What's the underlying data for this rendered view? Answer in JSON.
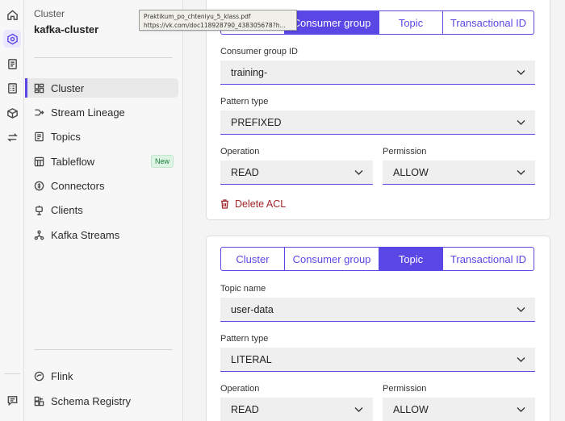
{
  "tooltip": {
    "line1": "Praktikum_po_chteniyu_5_klass.pdf",
    "line2": "https://vk.com/doc118928790_438305678?h..."
  },
  "rail": {
    "icons": [
      "home-icon",
      "environment-icon",
      "document-icon",
      "catalog-icon",
      "box-icon",
      "swap-icon",
      "chat-icon"
    ]
  },
  "sidebar": {
    "caption": "Cluster",
    "cluster_name": "kafka-cluster",
    "items": [
      {
        "label": "Cluster",
        "icon": "dashboard-icon",
        "active": true
      },
      {
        "label": "Stream Lineage",
        "icon": "lineage-icon"
      },
      {
        "label": "Topics",
        "icon": "topics-icon"
      },
      {
        "label": "Tableflow",
        "icon": "tableflow-icon",
        "badge": "New"
      },
      {
        "label": "Connectors",
        "icon": "connectors-icon"
      },
      {
        "label": "Clients",
        "icon": "clients-icon"
      },
      {
        "label": "Kafka Streams",
        "icon": "streams-icon"
      }
    ],
    "bottom_items": [
      {
        "label": "Flink",
        "icon": "flink-icon"
      },
      {
        "label": "Schema Registry",
        "icon": "schema-icon"
      }
    ]
  },
  "acl1": {
    "tabs": [
      "Consumer group",
      "Topic",
      "Transactional ID"
    ],
    "selected_tab": "Consumer group",
    "id_label": "Consumer group ID",
    "id_value": "training-",
    "pattern_label": "Pattern type",
    "pattern_value": "PREFIXED",
    "operation_label": "Operation",
    "operation_value": "READ",
    "permission_label": "Permission",
    "permission_value": "ALLOW",
    "delete_label": "Delete ACL"
  },
  "acl2": {
    "tabs": [
      "Cluster",
      "Consumer group",
      "Topic",
      "Transactional ID"
    ],
    "selected_tab": "Topic",
    "id_label": "Topic name",
    "id_value": "user-data",
    "pattern_label": "Pattern type",
    "pattern_value": "LITERAL",
    "operation_label": "Operation",
    "operation_value": "READ",
    "permission_label": "Permission",
    "permission_value": "ALLOW"
  },
  "colors": {
    "accent": "#5a47e6",
    "danger": "#a3242a",
    "badge_green": "#1a7a3d"
  }
}
